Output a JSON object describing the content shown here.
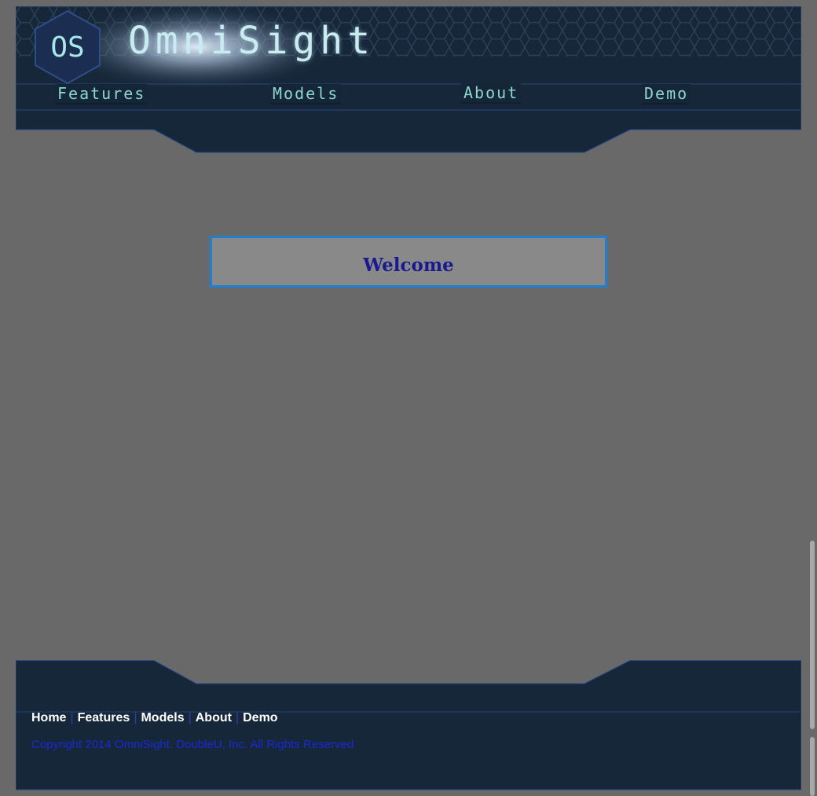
{
  "header": {
    "logo_text": "OS",
    "brand": "OmniSight"
  },
  "nav": {
    "items": [
      {
        "label": "Features"
      },
      {
        "label": "Models"
      },
      {
        "label": "About"
      },
      {
        "label": "Demo"
      }
    ]
  },
  "main": {
    "welcome_title": "Welcome"
  },
  "footer": {
    "links": [
      {
        "label": "Home"
      },
      {
        "label": "Features"
      },
      {
        "label": "Models"
      },
      {
        "label": "About"
      },
      {
        "label": "Demo"
      }
    ],
    "separator": "|",
    "copyright": "Copyright 2014 OmniSight. DoubleU, Inc. All Rights Reserved"
  },
  "colors": {
    "page_background": "#696969",
    "panel": "#16273a",
    "nav_text": "#8ed6d0",
    "welcome_border": "#1f80d0",
    "welcome_text": "#1a1a90",
    "copyright_text": "#1a2ad0"
  }
}
